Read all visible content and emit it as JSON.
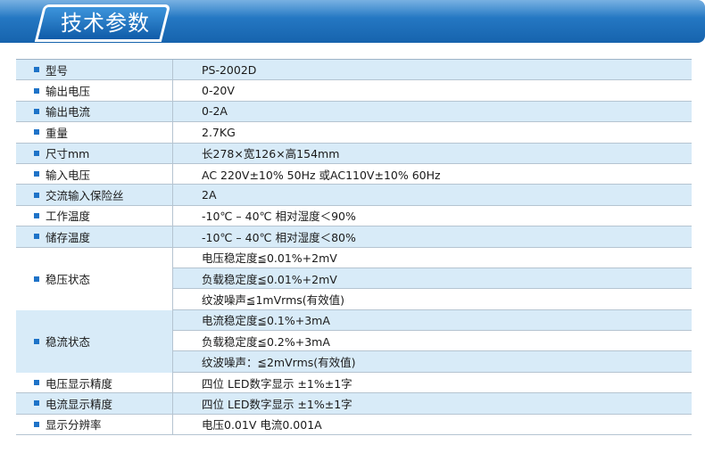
{
  "header": {
    "title": "技术参数"
  },
  "colors": {
    "banner": "#1663ad",
    "row_blue": "#d8ebf8",
    "bullet": "#1e73c8"
  },
  "specs": [
    {
      "label": "型号",
      "value": "PS-2002D"
    },
    {
      "label": "输出电压",
      "value": "0-20V"
    },
    {
      "label": "输出电流",
      "value": "0-2A"
    },
    {
      "label": "重量",
      "value": "2.7KG"
    },
    {
      "label": "尺寸mm",
      "value": "长278×宽126×高154mm"
    },
    {
      "label": "输入电压",
      "value": "AC 220V±10% 50Hz 或AC110V±10% 60Hz"
    },
    {
      "label": "交流输入保险丝",
      "value": "2A"
    },
    {
      "label": "工作温度",
      "value": "-10℃ – 40℃ 相对湿度＜90%"
    },
    {
      "label": "储存温度",
      "value": "-10℃ – 40℃ 相对湿度＜80%"
    }
  ],
  "voltage_stability": {
    "label": "稳压状态",
    "values": [
      "电压稳定度≦0.01%+2mV",
      "负载稳定度≦0.01%+2mV",
      "纹波噪声≦1mVrms(有效值)"
    ]
  },
  "current_stability": {
    "label": "稳流状态",
    "values": [
      "电流稳定度≦0.1%+3mA",
      "负载稳定度≦0.2%+3mA",
      "纹波噪声：≦2mVrms(有效值)"
    ]
  },
  "specs_tail": [
    {
      "label": "电压显示精度",
      "value": "四位 LED数字显示 ±1%±1字"
    },
    {
      "label": "电流显示精度",
      "value": "四位 LED数字显示 ±1%±1字"
    },
    {
      "label": "显示分辨率",
      "value": "电压0.01V 电流0.001A"
    }
  ]
}
